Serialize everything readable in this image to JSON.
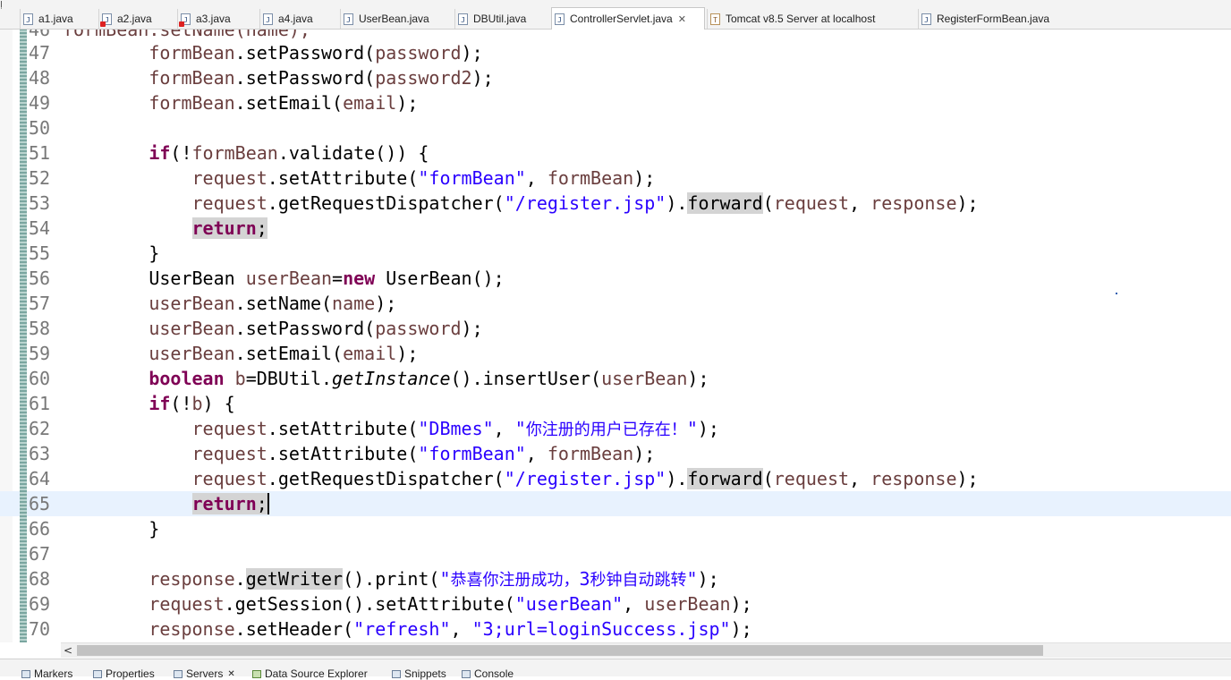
{
  "left_marker": "Ị",
  "tabs": [
    {
      "label": "a1.java",
      "icon": "java-file-icon",
      "error": false
    },
    {
      "label": "a2.java",
      "icon": "java-file-error-icon",
      "error": true
    },
    {
      "label": "a3.java",
      "icon": "java-file-error-icon",
      "error": true
    },
    {
      "label": "a4.java",
      "icon": "java-file-icon",
      "error": false
    },
    {
      "label": "UserBean.java",
      "icon": "java-file-icon",
      "error": false
    },
    {
      "label": "DBUtil.java",
      "icon": "java-file-icon",
      "error": false
    },
    {
      "label": "ControllerServlet.java",
      "icon": "java-file-icon",
      "error": false,
      "active": true,
      "close": "✕"
    },
    {
      "label": "Tomcat v8.5 Server at localhost",
      "icon": "tomcat-icon",
      "error": false
    },
    {
      "label": "RegisterFormBean.java",
      "icon": "java-file-icon",
      "error": false
    }
  ],
  "editor": {
    "partial_line_number": "46",
    "partial_line_code": "formBean.setName(name);",
    "current_line": "65",
    "line_numbers": [
      "47",
      "48",
      "49",
      "50",
      "51",
      "52",
      "53",
      "54",
      "55",
      "56",
      "57",
      "58",
      "59",
      "60",
      "61",
      "62",
      "63",
      "64",
      "65",
      "66",
      "67",
      "68",
      "69",
      "70"
    ],
    "code": {
      "l47": [
        "formBean",
        ".setPassword(",
        "password",
        ");"
      ],
      "l48": [
        "formBean",
        ".setPassword(",
        "password2",
        ");"
      ],
      "l49": [
        "formBean",
        ".setEmail(",
        "email",
        ");"
      ],
      "l51": [
        "if",
        "(!",
        "formBean",
        ".validate()) {"
      ],
      "l52": [
        "request",
        ".setAttribute(",
        "\"formBean\"",
        ", ",
        "formBean",
        ");"
      ],
      "l53": [
        "request",
        ".getRequestDispatcher(",
        "\"/register.jsp\"",
        ").",
        "forward",
        "(",
        "request",
        ", ",
        "response",
        ");"
      ],
      "l54": [
        "return",
        ";"
      ],
      "l55": [
        "}"
      ],
      "l56": [
        "UserBean ",
        "userBean",
        "=",
        "new",
        " UserBean();"
      ],
      "l57": [
        "userBean",
        ".setName(",
        "name",
        ");"
      ],
      "l58": [
        "userBean",
        ".setPassword(",
        "password",
        ");"
      ],
      "l59": [
        "userBean",
        ".setEmail(",
        "email",
        ");"
      ],
      "l60": [
        "boolean",
        " ",
        "b",
        "=DBUtil.",
        "getInstance",
        "().insertUser(",
        "userBean",
        ");"
      ],
      "l61": [
        "if",
        "(!",
        "b",
        ") {"
      ],
      "l62": [
        "request",
        ".setAttribute(",
        "\"DBmes\"",
        ", ",
        "\"",
        "你注册的用户已存在！",
        "\"",
        ");"
      ],
      "l63": [
        "request",
        ".setAttribute(",
        "\"formBean\"",
        ", ",
        "formBean",
        ");"
      ],
      "l64": [
        "request",
        ".getRequestDispatcher(",
        "\"/register.jsp\"",
        ").",
        "forward",
        "(",
        "request",
        ", ",
        "response",
        ");"
      ],
      "l65": [
        "return",
        ";"
      ],
      "l66": [
        "}"
      ],
      "l68": [
        "response",
        ".",
        "getWriter",
        "().print(",
        "\"",
        "恭喜你注册成功，",
        "3",
        "秒钟自动跳转",
        "\"",
        ");"
      ],
      "l69": [
        "request",
        ".getSession().setAttribute(",
        "\"userBean\"",
        ", ",
        "userBean",
        ");"
      ],
      "l70": [
        "response",
        ".setHeader(",
        "\"refresh\"",
        ", ",
        "\"3;url=loginSuccess.jsp\"",
        ");"
      ]
    }
  },
  "hscroll": {
    "left_arrow": "<"
  },
  "bottom_tabs": [
    {
      "label": "Markers",
      "icon": "markers-icon"
    },
    {
      "label": "Properties",
      "icon": "properties-icon"
    },
    {
      "label": "Servers",
      "icon": "servers-icon",
      "close": "✕"
    },
    {
      "label": "Data Source Explorer",
      "icon": "data-source-icon"
    },
    {
      "label": "Snippets",
      "icon": "snippets-icon"
    },
    {
      "label": "Console",
      "icon": "console-icon"
    }
  ],
  "colors": {
    "keyword": "#7f0055",
    "string": "#2a00ff",
    "variable": "#6a3e3e",
    "current_line": "#e8f2fe"
  }
}
